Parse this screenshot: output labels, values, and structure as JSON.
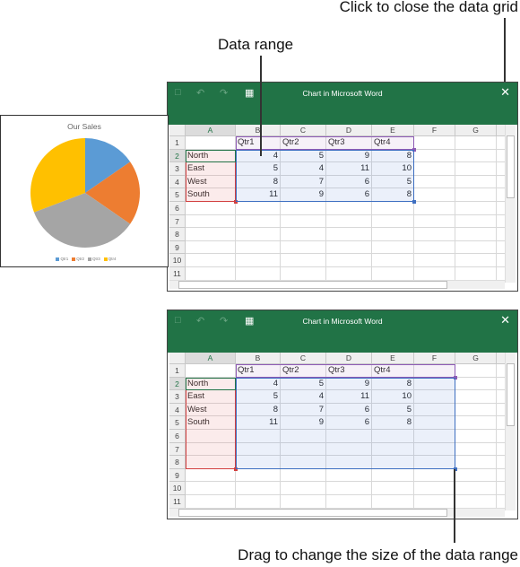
{
  "callouts": {
    "close": "Click to close the data grid",
    "range": "Data range",
    "drag": "Drag to change the size of the data range"
  },
  "window_title": "Chart in Microsoft Word",
  "icons": {
    "save": "save-icon",
    "undo": "undo-icon",
    "redo": "redo-icon",
    "edit_in_excel": "excel-icon",
    "close": "close-icon"
  },
  "columns": [
    "A",
    "B",
    "C",
    "D",
    "E",
    "F",
    "G"
  ],
  "cells": [
    [
      "",
      "Qtr1",
      "Qtr2",
      "Qtr3",
      "Qtr4"
    ],
    [
      "North",
      "4",
      "5",
      "9",
      "8"
    ],
    [
      "East",
      "5",
      "4",
      "11",
      "10"
    ],
    [
      "West",
      "8",
      "7",
      "6",
      "5"
    ],
    [
      "South",
      "11",
      "9",
      "6",
      "8"
    ]
  ],
  "windows": [
    {
      "rows": 10,
      "ranges": {
        "series": "B1:E1",
        "categories": "A2:A5",
        "values": "B2:E5"
      },
      "active_cell": "A2"
    },
    {
      "rows": 10,
      "ranges": {
        "series": "B1:F1",
        "categories": "A2:A8",
        "values": "B2:F8"
      },
      "active_cell": "A2"
    }
  ],
  "colors": {
    "titlebar": "#217346",
    "series_range": "#8e5bb5",
    "category_range": "#d23f3f",
    "values_range": "#3e6fc1",
    "active_cell": "#217346"
  },
  "chart_data": {
    "type": "pie",
    "title": "Our Sales",
    "categories": [
      "Qtr1",
      "Qtr2",
      "Qtr3",
      "Qtr4"
    ],
    "values": [
      4,
      5,
      9,
      8
    ],
    "colors": [
      "#5b9bd5",
      "#ed7d31",
      "#a5a5a5",
      "#ffc000"
    ],
    "legend": "bottom"
  }
}
